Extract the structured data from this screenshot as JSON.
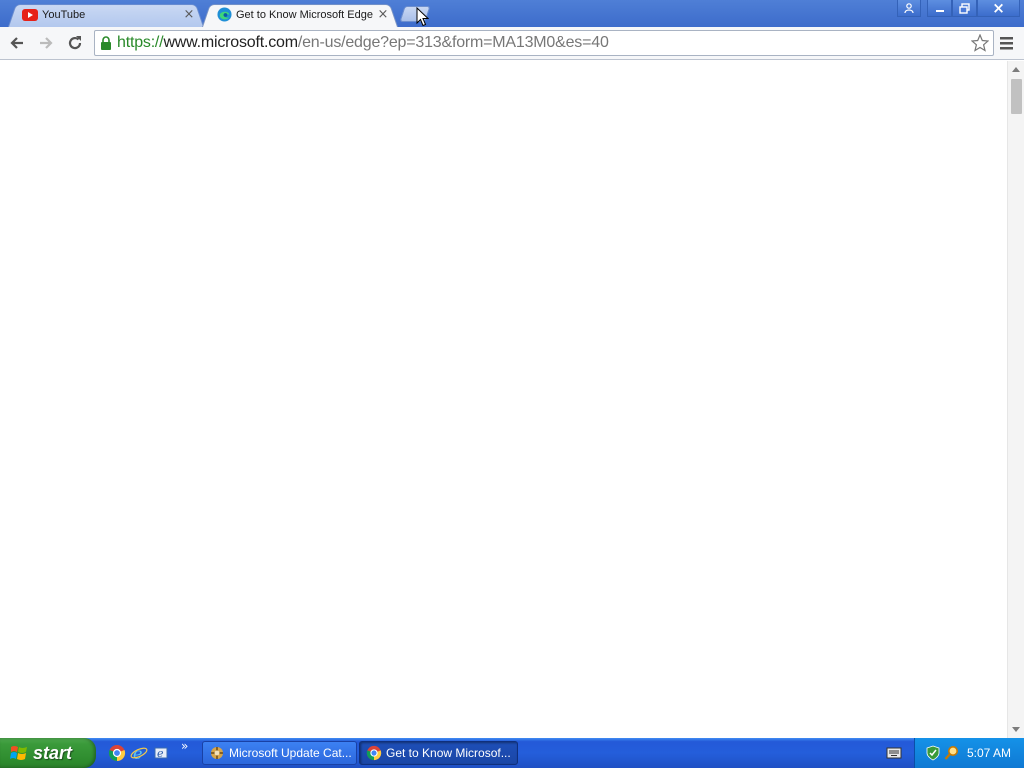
{
  "browser": {
    "tabs": [
      {
        "label": "YouTube",
        "active": false,
        "icon": "youtube-icon"
      },
      {
        "label": "Get to Know Microsoft Edge",
        "active": true,
        "icon": "edge-icon"
      }
    ],
    "close_glyph": "×",
    "address": {
      "scheme": "https://",
      "host": "www.microsoft.com",
      "path": "/en-us/edge?ep=313&form=MA13M0&es=40"
    }
  },
  "window_controls": {
    "user": "user-icon",
    "minimize": "minimize-icon",
    "restore": "restore-icon",
    "close": "×"
  },
  "taskbar": {
    "start_label": "start",
    "tasks": [
      {
        "label": "Microsoft Update Cat...",
        "icon": "update-catalog-icon"
      },
      {
        "label": "Get to Know Microsof...",
        "icon": "chrome-icon"
      }
    ],
    "quick_launch_more": "»",
    "clock": "5:07 AM"
  },
  "colors": {
    "titlebar": "#4f7fd6",
    "taskbar": "#245edb",
    "start_button": "#3a9a3a",
    "secure_scheme": "#2a8a2a"
  }
}
